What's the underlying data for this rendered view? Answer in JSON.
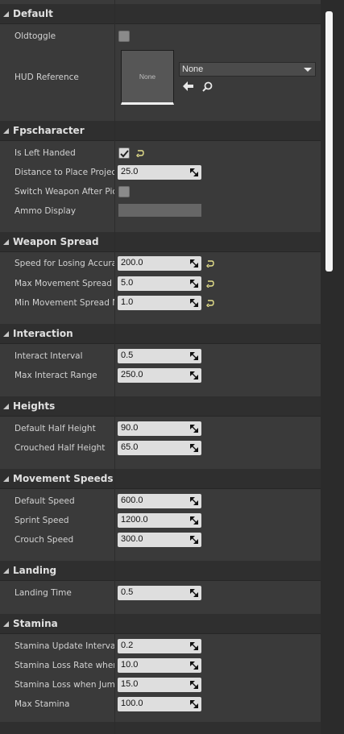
{
  "colors": {
    "panel": "#3a3a3a",
    "category_header": "#2f2f2f",
    "field_bg": "#dedede",
    "reset_arrow": "#e5e08a",
    "scroll_thumb": "#f4f4f4"
  },
  "categories": {
    "default": {
      "label": "Default"
    },
    "fpscharacter": {
      "label": "Fpscharacter"
    },
    "weapon_spread": {
      "label": "Weapon Spread"
    },
    "interaction": {
      "label": "Interaction"
    },
    "heights": {
      "label": "Heights"
    },
    "movement_speeds": {
      "label": "Movement Speeds"
    },
    "landing": {
      "label": "Landing"
    },
    "stamina": {
      "label": "Stamina"
    }
  },
  "props": {
    "oldtoggle": {
      "label": "Oldtoggle",
      "checked": false
    },
    "hud_reference": {
      "label": "HUD Reference",
      "thumbnail_text": "None",
      "value": "None",
      "icons": [
        "arrow-left-icon",
        "search-icon"
      ]
    },
    "is_left_handed": {
      "label": "Is Left Handed",
      "checked": true
    },
    "distance_to_place": {
      "label": "Distance to Place Project",
      "value": "25.0"
    },
    "switch_weapon": {
      "label": "Switch Weapon After Pic",
      "checked": false
    },
    "ammo_display": {
      "label": "Ammo Display"
    },
    "speed_losing": {
      "label": "Speed for Losing Accurac",
      "value": "200.0"
    },
    "max_movement_spread": {
      "label": "Max Movement Spread M",
      "value": "5.0"
    },
    "min_movement_spread": {
      "label": "Min Movement Spread M",
      "value": "1.0"
    },
    "interact_interval": {
      "label": "Interact Interval",
      "value": "0.5"
    },
    "max_interact_range": {
      "label": "Max Interact Range",
      "value": "250.0"
    },
    "default_half_height": {
      "label": "Default Half Height",
      "value": "90.0"
    },
    "crouched_half_height": {
      "label": "Crouched Half Height",
      "value": "65.0"
    },
    "default_speed": {
      "label": "Default Speed",
      "value": "600.0"
    },
    "sprint_speed": {
      "label": "Sprint Speed",
      "value": "1200.0"
    },
    "crouch_speed": {
      "label": "Crouch Speed",
      "value": "300.0"
    },
    "landing_time": {
      "label": "Landing Time",
      "value": "0.5"
    },
    "stamina_update_interval": {
      "label": "Stamina Update Interval",
      "value": "0.2"
    },
    "stamina_loss_rate": {
      "label": "Stamina Loss Rate when",
      "value": "10.0"
    },
    "stamina_loss_jump": {
      "label": "Stamina Loss when Jum",
      "value": "15.0"
    },
    "max_stamina": {
      "label": "Max Stamina",
      "value": "100.0"
    }
  }
}
